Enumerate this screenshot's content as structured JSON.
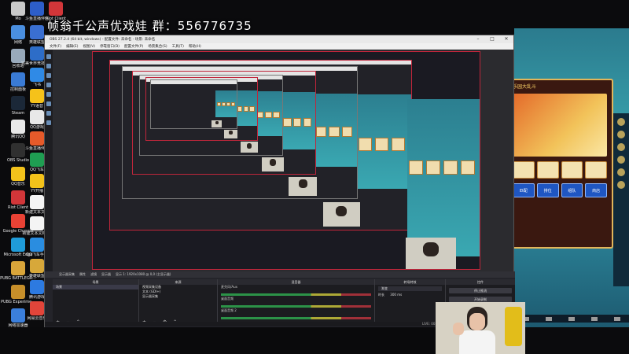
{
  "overlay": {
    "title": "帧翁千公声优戏娃 群：556776735"
  },
  "desktop": {
    "icons_left": [
      {
        "label": "Mo",
        "icon": "app-icon",
        "color": "#c9c9c9"
      },
      {
        "label": "网络",
        "icon": "network-icon",
        "color": "#4a8fe0"
      },
      {
        "label": "回收站",
        "icon": "recycle-bin-icon",
        "color": "#9ab"
      },
      {
        "label": "控制面板",
        "icon": "control-panel-icon",
        "color": "#3a7bd5"
      },
      {
        "label": "Steam",
        "icon": "steam-icon",
        "color": "#1b2838"
      },
      {
        "label": "腾讯QQ",
        "icon": "qq-icon",
        "color": "#e8e8e8"
      },
      {
        "label": "OBS Studio",
        "icon": "obs-icon",
        "color": "#303030"
      },
      {
        "label": "QQ音乐",
        "icon": "qq-music-icon",
        "color": "#f2c21b"
      },
      {
        "label": "Riot Client",
        "icon": "riot-client-icon",
        "color": "#d13639"
      },
      {
        "label": "Google Chrome",
        "icon": "chrome-icon",
        "color": "#e94235"
      },
      {
        "label": "Microsoft Edge",
        "icon": "edge-icon",
        "color": "#1f9bd8"
      },
      {
        "label": "PUBG BATTLEGR...",
        "icon": "pubg-icon",
        "color": "#d9a53a"
      },
      {
        "label": "PUBG Experime...",
        "icon": "pubg-exp-icon",
        "color": "#c78f2a"
      },
      {
        "label": "网络加速器",
        "icon": "accelerator-icon",
        "color": "#3b7fdc"
      }
    ],
    "icons_second": [
      {
        "label": "英雄联盟",
        "icon": "lol-icon",
        "color": "#3a6fd1"
      },
      {
        "label": "完美世界竞技平台",
        "icon": "perfect-world-icon",
        "color": "#2d6dc8"
      },
      {
        "label": "飞书",
        "icon": "feishu-icon",
        "color": "#2f8ae6"
      },
      {
        "label": "YY语音",
        "icon": "yy-icon",
        "color": "#f5c21a"
      },
      {
        "label": "QQ游戏",
        "icon": "qq-game-icon",
        "color": "#e8e8e8"
      },
      {
        "label": "斗鱼直播伴侣",
        "icon": "douyu-icon",
        "color": "#e65a2a"
      },
      {
        "label": "QQ飞车",
        "icon": "qq-speed-icon",
        "color": "#1f9e52"
      },
      {
        "label": "YY开播",
        "icon": "yy-live-icon",
        "color": "#f3c21a"
      },
      {
        "label": "新建文本文档",
        "icon": "text-file-icon",
        "color": "#f4f4f4"
      },
      {
        "label": "新建文本文档(2)",
        "icon": "text-file-icon",
        "color": "#f4f4f4"
      },
      {
        "label": "QQ飞车手游",
        "icon": "qq-speed-mobile-icon",
        "color": "#2a8de0"
      },
      {
        "label": "英雄联盟",
        "icon": "lol-icon",
        "color": "#d7a83a"
      },
      {
        "label": "腾讯游戏",
        "icon": "tencent-game-icon",
        "color": "#2d7ae0"
      },
      {
        "label": "网易云音乐",
        "icon": "netease-icon",
        "color": "#e2453a"
      }
    ],
    "top_icons": [
      {
        "label": "斗鱼直播伴侣",
        "icon": "douyu-top-icon",
        "color": "#2d5ec9"
      },
      {
        "label": "Riot Client",
        "icon": "riot-top-icon",
        "color": "#d13639"
      }
    ]
  },
  "obs": {
    "title": "OBS 27.2.4 (64 bit, windows) - 配置文件: 未命名 - 场景: 未命名",
    "menus": [
      "文件(F)",
      "编辑(E)",
      "视图(V)",
      "停靠窗口(D)",
      "配置文件(P)",
      "场景集合(S)",
      "工具(T)",
      "帮助(H)"
    ],
    "toolbar": [
      "显示器采集",
      "属性",
      "滤镜",
      "显示器",
      "显示 1: 1920x1080 @ 0,0 (主显示器)"
    ],
    "docks": {
      "scenes": {
        "title": "场景",
        "items": [
          "场景"
        ]
      },
      "sources": {
        "title": "来源",
        "items": [
          "视频采集设备",
          "文本 (GDI+)",
          "显示器采集"
        ]
      },
      "mixer": {
        "title": "混音器",
        "channels": [
          "麦克风/Aux",
          "桌面音频",
          "桌面音频 2"
        ]
      },
      "transitions": {
        "title": "转场特效",
        "value": "渐变",
        "duration_label": "时长",
        "duration": "300 ms"
      },
      "controls": {
        "title": "控件",
        "buttons": [
          "停止推流",
          "开始录制",
          "启动虚拟摄像机",
          "工作室模式",
          "设置",
          "退出"
        ]
      }
    },
    "status": "LIVE: 00:00:00   REC: 00:00:00   CPU: 1.1%, 60.00 fps"
  },
  "game": {
    "title": "乐园大乱斗",
    "buttons": [
      "匹配",
      "排位",
      "组队",
      "商店"
    ]
  },
  "colors": {
    "preview_border": "#c0263b",
    "obs_bg": "#2b2b2f",
    "game_bg": "#3aa6b0"
  }
}
